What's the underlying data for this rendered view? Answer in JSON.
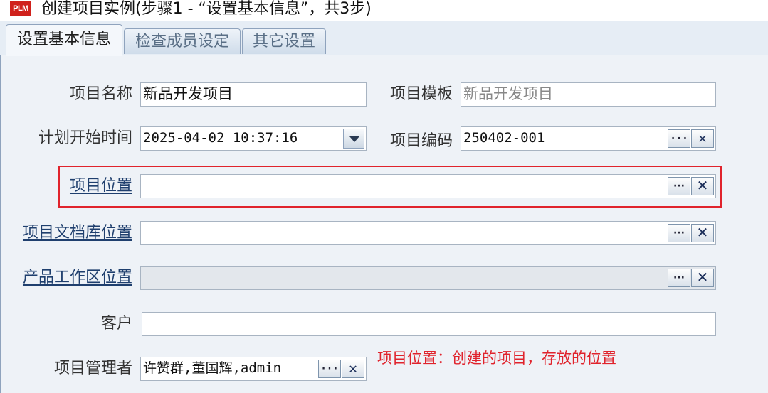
{
  "window": {
    "logo": "PLM",
    "title": "创建项目实例(步骤1 - “设置基本信息”，共3步)"
  },
  "tabs": [
    {
      "label": "设置基本信息",
      "active": true
    },
    {
      "label": "检查成员设定",
      "active": false
    },
    {
      "label": "其它设置",
      "active": false
    }
  ],
  "form": {
    "project_name": {
      "label": "项目名称",
      "value": "新品开发项目"
    },
    "project_template": {
      "label": "项目模板",
      "value": "新品开发项目"
    },
    "plan_start_time": {
      "label": "计划开始时间",
      "value": "2025-04-02 10:37:16"
    },
    "project_code": {
      "label": "项目编码",
      "value": "250402-001"
    },
    "project_location": {
      "label": "项目位置",
      "value": ""
    },
    "doc_library_location": {
      "label": "项目文档库位置",
      "value": ""
    },
    "product_workspace_location": {
      "label": "产品工作区位置",
      "value": ""
    },
    "customer": {
      "label": "客户",
      "value": ""
    },
    "project_manager": {
      "label": "项目管理者",
      "value": "许赞群,董国辉,admin"
    }
  },
  "buttons": {
    "browse": "···",
    "clear": "✕"
  },
  "annotation": "项目位置：创建的项目，存放的位置",
  "colors": {
    "annotation": "#e0232c",
    "link_label": "#1f3f6e",
    "panel_bg": "#eef2f7"
  }
}
